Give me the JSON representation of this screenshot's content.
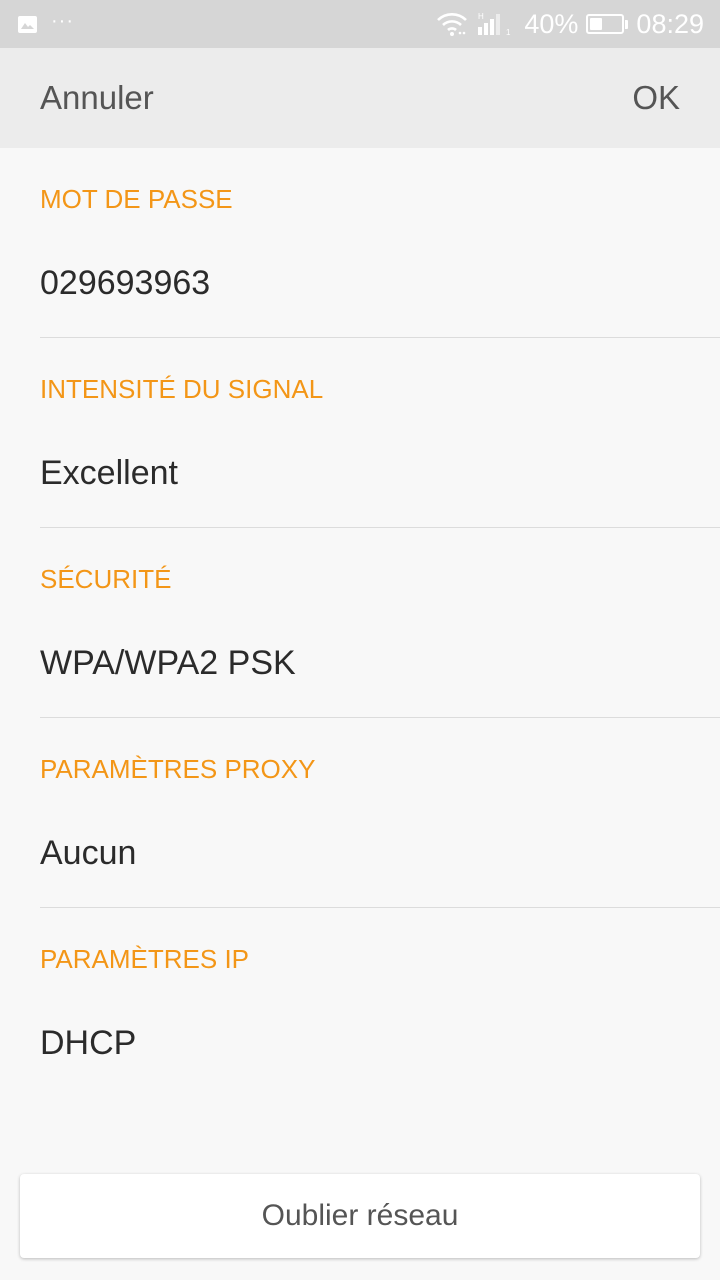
{
  "status_bar": {
    "icons": [
      "image-icon",
      "more-dots-icon",
      "wifi-icon",
      "signal-icon",
      "battery-icon"
    ],
    "dots": "···",
    "battery_level": 0.4,
    "battery_percent": "40%",
    "time": "08:29"
  },
  "action_bar": {
    "cancel_label": "Annuler",
    "ok_label": "OK"
  },
  "sections": [
    {
      "label": "MOT DE PASSE",
      "value": "029693963"
    },
    {
      "label": "INTENSITÉ DU SIGNAL",
      "value": "Excellent"
    },
    {
      "label": "SÉCURITÉ",
      "value": "WPA/WPA2 PSK"
    },
    {
      "label": "PARAMÈTRES PROXY",
      "value": "Aucun"
    },
    {
      "label": "PARAMÈTRES IP",
      "value": "DHCP"
    }
  ],
  "forget_label": "Oublier réseau",
  "colors": {
    "accent": "#f39617",
    "status_bar": "#d6d6d6",
    "action_bar": "#ececec",
    "background": "#f8f8f8"
  }
}
